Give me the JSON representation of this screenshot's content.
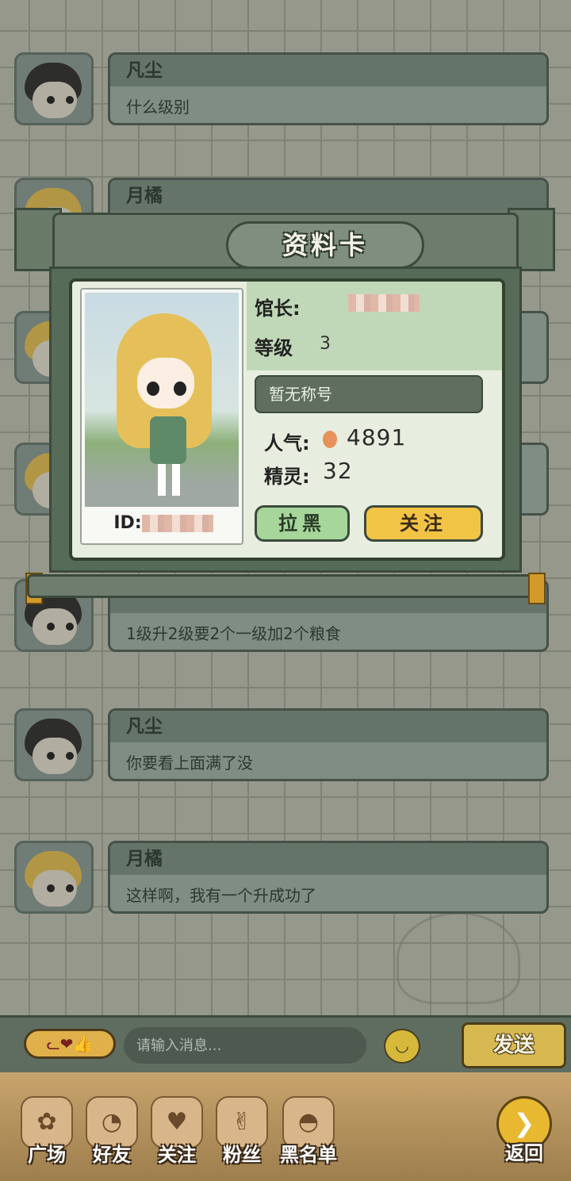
{
  "chat": {
    "messages": [
      {
        "name": "凡尘",
        "text": "什么级别",
        "avatar": "boy"
      },
      {
        "name": "月橘",
        "text": "",
        "avatar": "girl"
      },
      {
        "name": "",
        "text": "",
        "avatar": "girl"
      },
      {
        "name": "",
        "text": "",
        "avatar": "girl"
      },
      {
        "name": "",
        "text": "1级升2级要2个一级加2个粮食",
        "avatar": "boy"
      },
      {
        "name": "凡尘",
        "text": "你要看上面满了没",
        "avatar": "boy"
      },
      {
        "name": "月橘",
        "text": "这样啊，我有一个升成功了",
        "avatar": "girl"
      }
    ]
  },
  "profile_card": {
    "title": "资料卡",
    "owner_label": "馆长:",
    "level_label": "等级",
    "level_value": "3",
    "title_badge": "暂无称号",
    "popularity_label": "人气:",
    "popularity_value": "4891",
    "sprite_label": "精灵:",
    "sprite_value": "32",
    "id_label": "ID:",
    "block_button": "拉黑",
    "follow_button": "关注"
  },
  "input_bar": {
    "emote_icons": "ᓚ❤👍",
    "placeholder": "请输入消息...",
    "send_button": "发送"
  },
  "bottom_nav": {
    "items": [
      {
        "label": "广场",
        "icon": "plaza-icon"
      },
      {
        "label": "好友",
        "icon": "friends-icon"
      },
      {
        "label": "关注",
        "icon": "follow-paw-icon"
      },
      {
        "label": "粉丝",
        "icon": "fans-icon"
      },
      {
        "label": "黑名单",
        "icon": "blacklist-icon"
      }
    ],
    "back_label": "返回"
  },
  "colors": {
    "accent_gold": "#f2c446",
    "green_button": "#a6d69a",
    "panel_green": "#566b58"
  }
}
